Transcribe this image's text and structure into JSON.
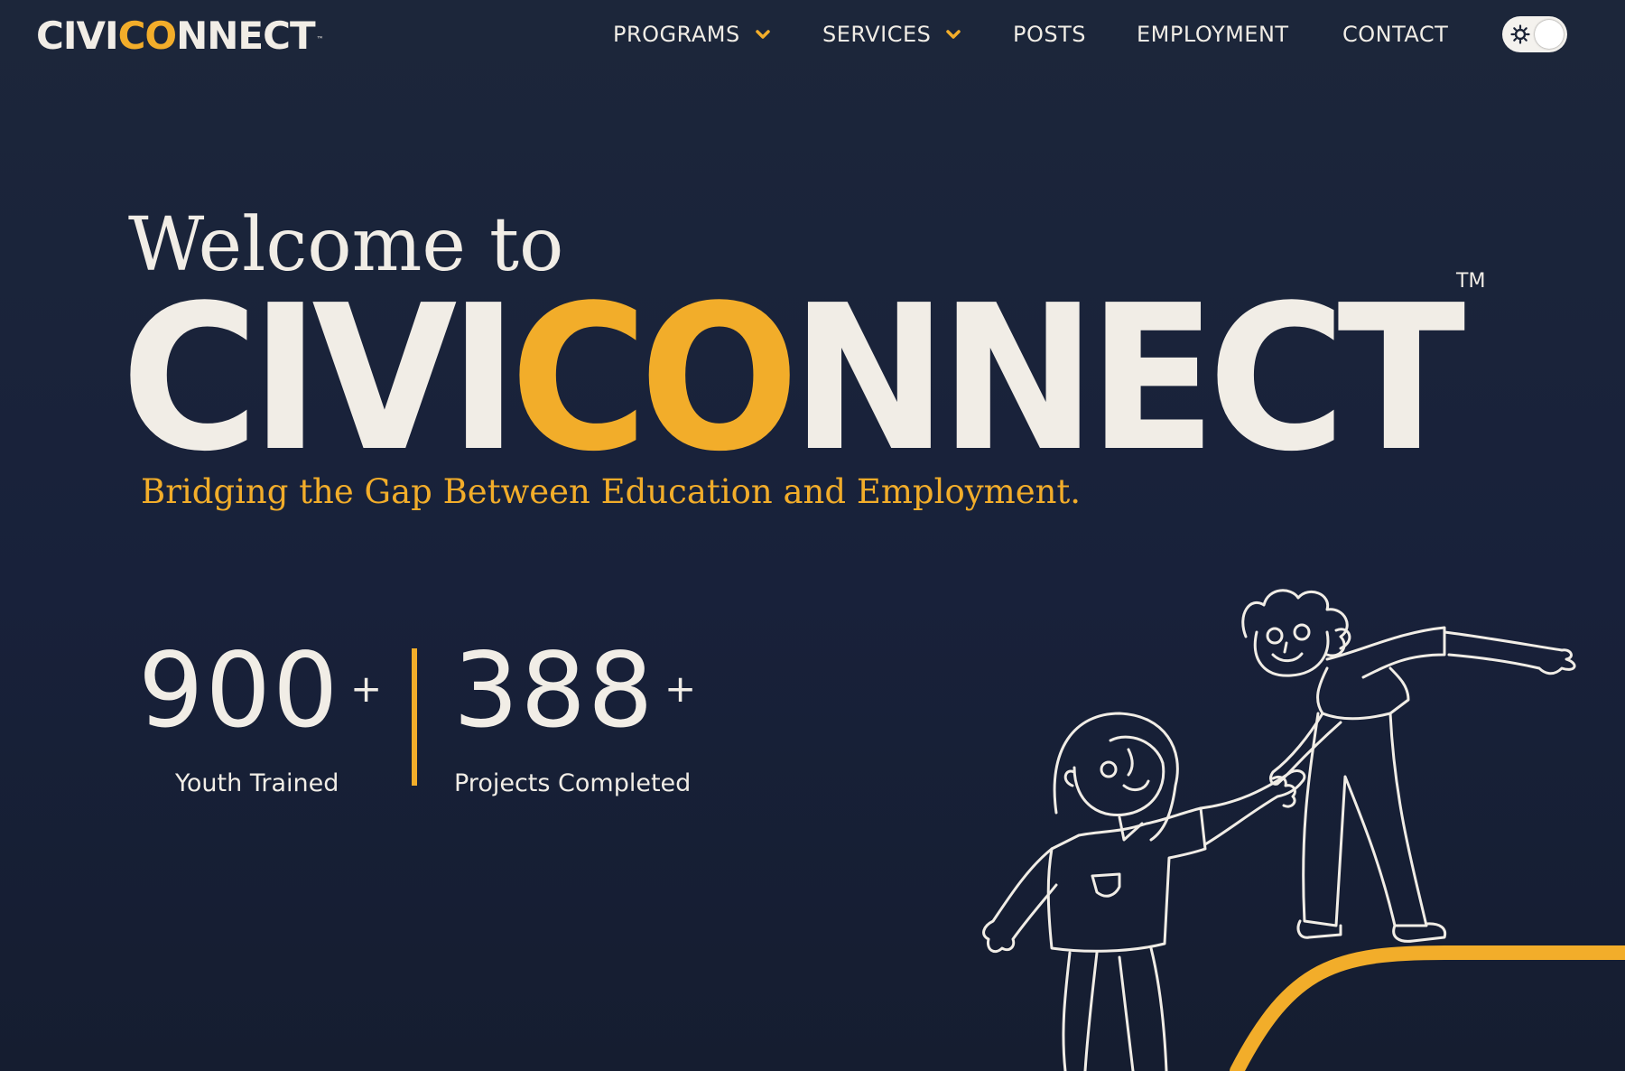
{
  "header": {
    "logo": {
      "prefix": "CIVI",
      "accent": "CO",
      "suffix": "NNECT",
      "tm": "™"
    },
    "nav": [
      {
        "label": "PROGRAMS",
        "has_dropdown": true
      },
      {
        "label": "SERVICES",
        "has_dropdown": true
      },
      {
        "label": "POSTS",
        "has_dropdown": false
      },
      {
        "label": "EMPLOYMENT",
        "has_dropdown": false
      },
      {
        "label": "CONTACT",
        "has_dropdown": false
      }
    ],
    "theme_toggle": {
      "icon": "sun-icon",
      "state": "light"
    }
  },
  "hero": {
    "welcome": "Welcome to",
    "brand": {
      "prefix": "CIVI",
      "accent": "CO",
      "suffix": "NNECT",
      "tm": "TM"
    },
    "tagline": "Bridging the Gap Between Education and Employment."
  },
  "stats": [
    {
      "value": "900",
      "suffix": "+",
      "label": "Youth Trained"
    },
    {
      "value": "388",
      "suffix": "+",
      "label": "Projects Completed"
    }
  ],
  "colors": {
    "background": "#1a2236",
    "accent": "#f2ad2a",
    "text": "#f1ede6"
  },
  "illustration": {
    "icon": "helping-hand-people-illustration"
  }
}
